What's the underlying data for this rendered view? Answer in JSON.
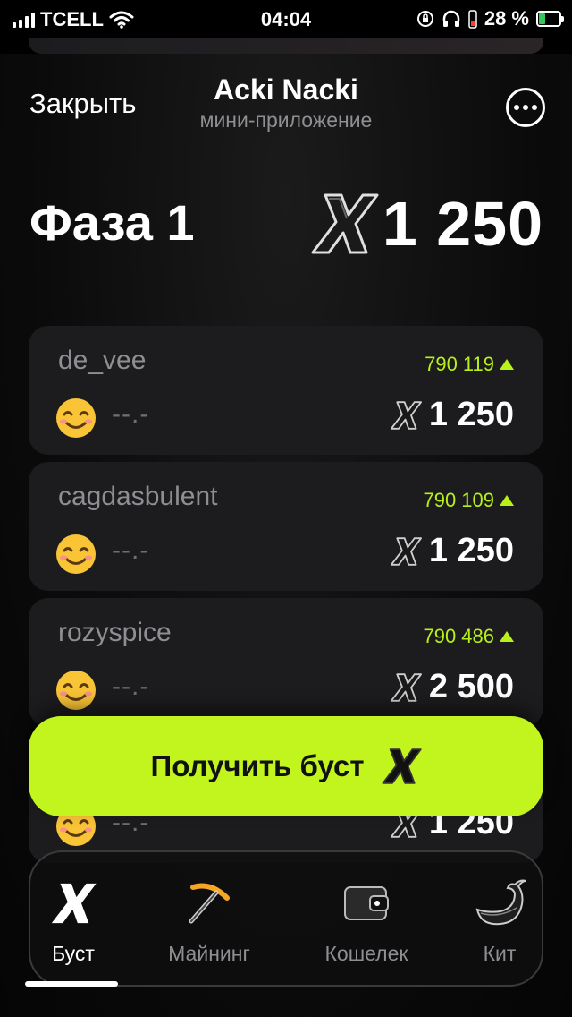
{
  "status_bar": {
    "carrier": "TCELL",
    "time": "04:04",
    "battery_percent": "28 %",
    "battery_level": 0.28,
    "icons": [
      "signal-icon",
      "wifi-icon",
      "orientation-lock-icon",
      "headphones-icon",
      "battery-icon"
    ]
  },
  "header": {
    "close_label": "Закрыть",
    "title": "Acki Nacki",
    "subtitle": "мини-приложение",
    "more_icon": "more-icon"
  },
  "phase": {
    "title": "Фаза 1",
    "amount": "1 250"
  },
  "cards": [
    {
      "user": "de_vee",
      "score": "790 119",
      "placeholder": "--.-",
      "value": "1 250"
    },
    {
      "user": "cagdasbulent",
      "score": "790 109",
      "placeholder": "--.-",
      "value": "1 250"
    },
    {
      "user": "rozyspice",
      "score": "790 486",
      "placeholder": "--.-",
      "value": "2 500"
    },
    {
      "user": "",
      "score": "",
      "placeholder": "--.-",
      "value": "1 250"
    }
  ],
  "boost_button": {
    "label": "Получить буст"
  },
  "tabs": [
    {
      "label": "Буст",
      "icon": "x-logo-icon",
      "active": true
    },
    {
      "label": "Майнинг",
      "icon": "pickaxe-icon",
      "active": false
    },
    {
      "label": "Кошелек",
      "icon": "wallet-icon",
      "active": false
    },
    {
      "label": "Кит",
      "icon": "whale-icon",
      "active": false
    }
  ],
  "colors": {
    "accent": "#c2f51e",
    "score_green": "#b8f01a",
    "card_bg": "#1c1c1e",
    "text_muted": "#8e8e93"
  }
}
